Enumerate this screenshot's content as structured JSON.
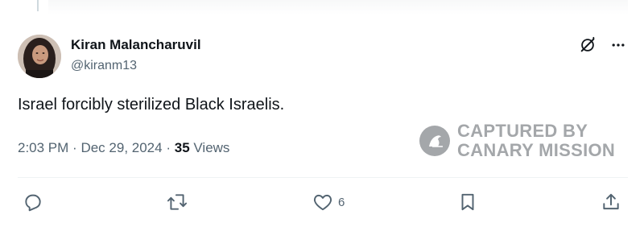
{
  "tweet": {
    "author_name": "Kiran Malancharuvil",
    "author_handle": "@kiranm13",
    "text": "Israel forcibly sterilized Black Israelis.",
    "time": "2:03 PM",
    "date": "Dec 29, 2024",
    "separator": "·",
    "views_count": "35",
    "views_label": "Views"
  },
  "watermark": {
    "line1": "CAPTURED BY",
    "line2": "CANARY MISSION"
  },
  "actions": {
    "likes_count": "6"
  },
  "icons": {
    "grok": "grok-icon",
    "more": "more-options-icon",
    "reply": "reply-icon",
    "retweet": "retweet-icon",
    "like": "like-icon",
    "bookmark": "bookmark-icon",
    "share": "share-icon"
  },
  "colors": {
    "primary_text": "#0f1419",
    "secondary_text": "#536471",
    "divider": "#eff3f4"
  }
}
